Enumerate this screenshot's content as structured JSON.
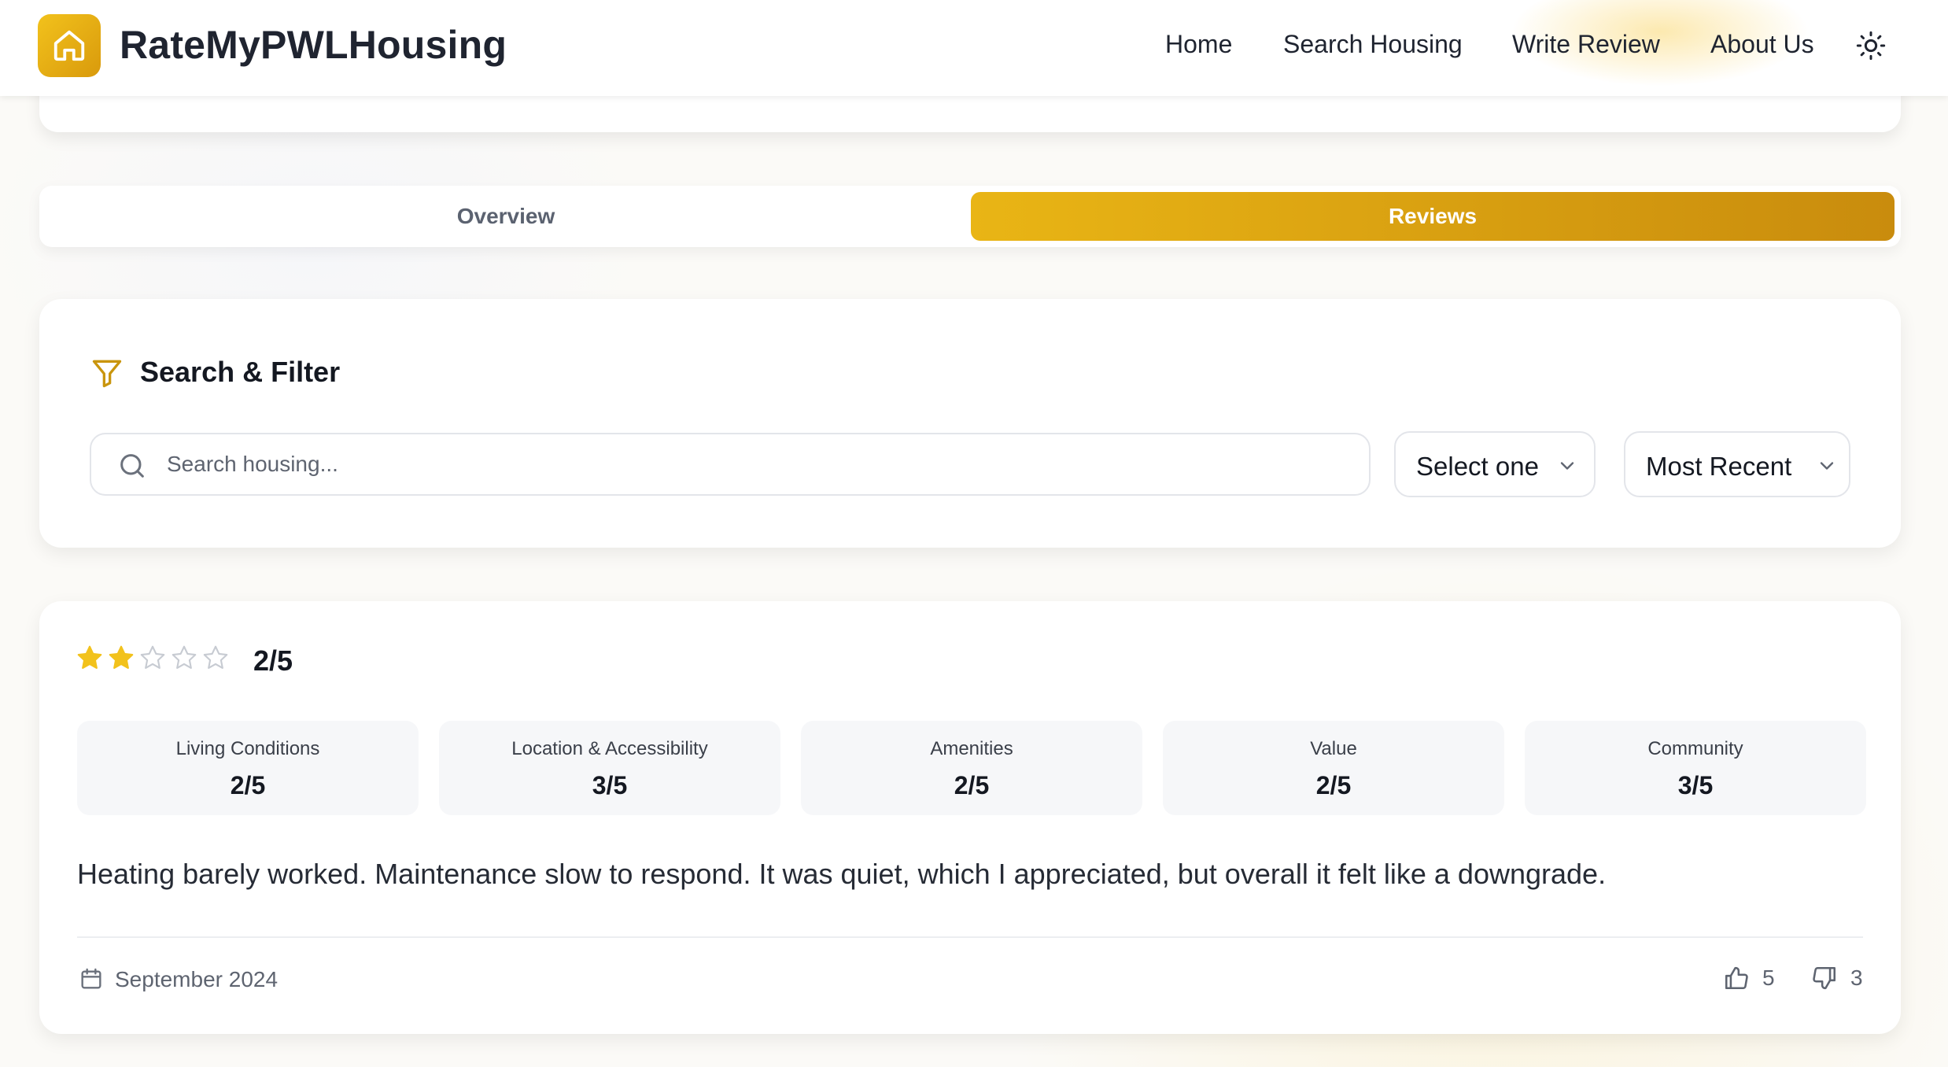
{
  "app": {
    "brand": "RateMyPWLHousing",
    "brand_color": "#e4ab12"
  },
  "nav": {
    "home": "Home",
    "search_housing": "Search Housing",
    "write_review": "Write Review",
    "about_us": "About Us",
    "theme_toggle_icon": "sun-icon"
  },
  "tabs": [
    {
      "label": "Overview",
      "active": false
    },
    {
      "label": "Reviews",
      "active": true
    }
  ],
  "filter": {
    "title": "Search & Filter",
    "search_placeholder": "Search housing...",
    "search_value": "",
    "type_select": "Select one",
    "sort_select": "Most Recent"
  },
  "review": {
    "rating": 2,
    "rating_max": 5,
    "rating_text": "2/5",
    "categories": [
      {
        "name": "Living Conditions",
        "value": "2/5"
      },
      {
        "name": "Location & Accessibility",
        "value": "3/5"
      },
      {
        "name": "Amenities",
        "value": "2/5"
      },
      {
        "name": "Value",
        "value": "2/5"
      },
      {
        "name": "Community",
        "value": "3/5"
      }
    ],
    "text": "Heating barely worked. Maintenance slow to respond. It was quiet, which I appreciated, but overall it felt like a downgrade.",
    "date": "September 2024",
    "helpful_count": "5",
    "unhelpful_count": "3"
  },
  "colors": {
    "star_filled": "#f2c21c",
    "star_empty": "#c7cbd2",
    "accent_gradient_start": "#e9b515",
    "accent_gradient_end": "#c98c0d"
  }
}
